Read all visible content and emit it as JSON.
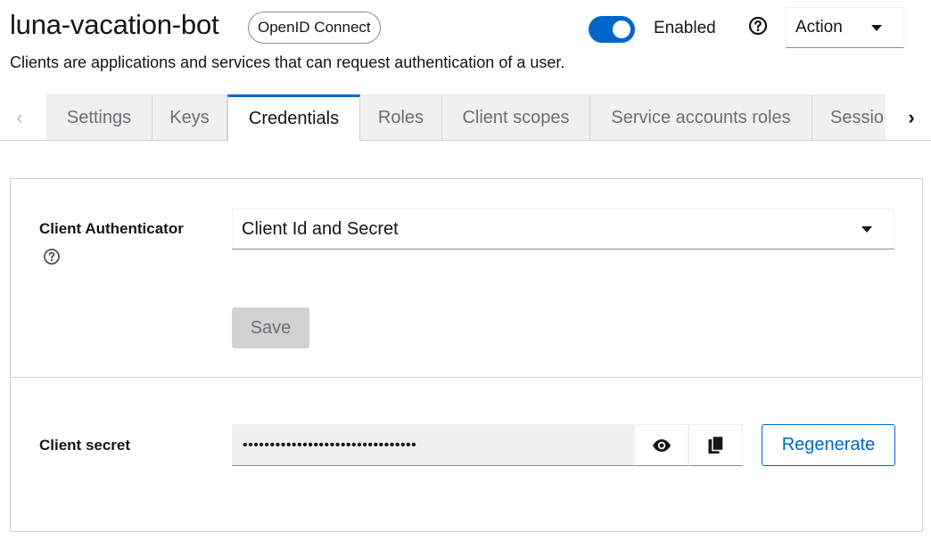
{
  "header": {
    "title": "luna-vacation-bot",
    "protocol_badge": "OpenID Connect",
    "subtitle": "Clients are applications and services that can request authentication of a user.",
    "enabled_label": "Enabled",
    "enabled": true,
    "help_icon": "question-circle-icon",
    "action_label": "Action"
  },
  "tabs": [
    {
      "label": "Settings",
      "active": false
    },
    {
      "label": "Keys",
      "active": false
    },
    {
      "label": "Credentials",
      "active": true
    },
    {
      "label": "Roles",
      "active": false
    },
    {
      "label": "Client scopes",
      "active": false
    },
    {
      "label": "Service accounts roles",
      "active": false
    },
    {
      "label": "Sessio",
      "active": false
    }
  ],
  "credentials": {
    "client_authenticator_label": "Client Authenticator",
    "client_authenticator_value": "Client Id and Secret",
    "save_label": "Save",
    "client_secret_label": "Client secret",
    "client_secret_value": "••••••••••••••••••••••••••••••••",
    "regenerate_label": "Regenerate"
  },
  "colors": {
    "primary": "#0066cc",
    "tab_inactive_bg": "#f0f0f0",
    "disabled_button_bg": "#d2d2d2"
  }
}
